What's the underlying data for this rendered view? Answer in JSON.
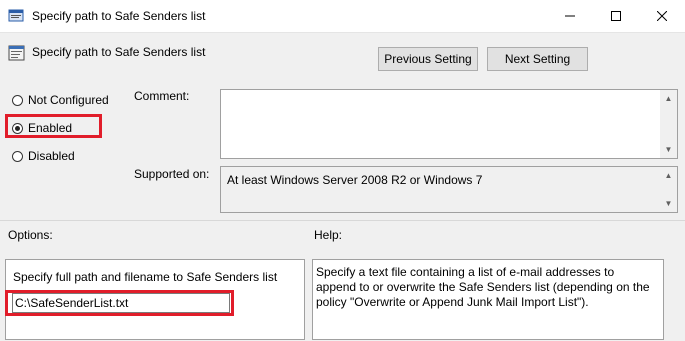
{
  "window": {
    "title": "Specify path to Safe Senders list"
  },
  "header": {
    "title": "Specify path to Safe Senders list"
  },
  "buttons": {
    "previous": "Previous Setting",
    "next": "Next Setting"
  },
  "radios": [
    {
      "label": "Not Configured",
      "checked": false
    },
    {
      "label": "Enabled",
      "checked": true
    },
    {
      "label": "Disabled",
      "checked": false
    }
  ],
  "comment": {
    "label": "Comment:",
    "value": ""
  },
  "supported": {
    "label": "Supported on:",
    "value": "At least Windows Server 2008 R2 or Windows 7"
  },
  "options": {
    "label": "Options:",
    "field_label": "Specify full path and filename to Safe Senders list",
    "field_value": "C:\\SafeSenderList.txt"
  },
  "help": {
    "label": "Help:",
    "text": "Specify a text file containing a list of e-mail addresses to append to or overwrite the Safe Senders list (depending on the policy \"Overwrite or Append Junk Mail Import List\")."
  },
  "colors": {
    "highlight": "#e11d2a"
  }
}
